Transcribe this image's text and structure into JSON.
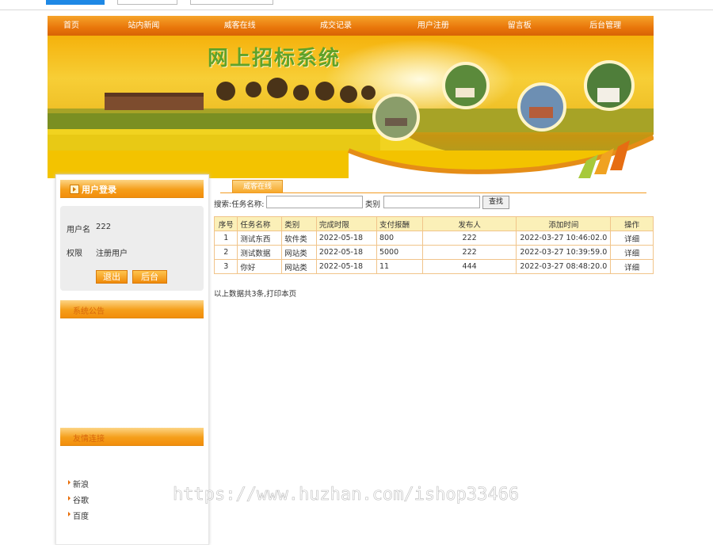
{
  "colors": {
    "accent": "#f28d0b",
    "nav_top": "#f6a42a",
    "nav_bottom": "#d86405",
    "table_head_bg": "#fbf0b8",
    "table_border": "#f1c48a"
  },
  "nav": [
    {
      "label": "首页"
    },
    {
      "label": "站内新闻"
    },
    {
      "label": "威客在线"
    },
    {
      "label": "成交记录"
    },
    {
      "label": "用户注册"
    },
    {
      "label": "留言板"
    },
    {
      "label": "后台管理"
    }
  ],
  "banner": {
    "title": "网上招标系统"
  },
  "login": {
    "title": "用户登录",
    "username_label": "用户名",
    "username_value": "222",
    "role_label": "权限",
    "role_value": "注册用户",
    "logout_button": "退出",
    "admin_button": "后台",
    "icon": "arrow-right-icon"
  },
  "notice": {
    "title": "系统公告"
  },
  "links": {
    "title": "友情连接",
    "items": [
      "新浪",
      "谷歌",
      "百度"
    ]
  },
  "main": {
    "tab_label": "威客在线",
    "search": {
      "label_prefix": "搜索:任务名称:",
      "category_label": "类别",
      "task_name_value": "",
      "category_value": "",
      "button": "查找"
    },
    "table": {
      "headers": [
        "序号",
        "任务名称",
        "类别",
        "完成时限",
        "支付报酬",
        "发布人",
        "添加时间",
        "操作"
      ],
      "rows": [
        [
          "1",
          "测试东西",
          "软件类",
          "2022-05-18",
          "800",
          "222",
          "2022-03-27 10:46:02.0",
          "详细"
        ],
        [
          "2",
          "测试数据",
          "网站类",
          "2022-05-18",
          "5000",
          "222",
          "2022-03-27 10:39:59.0",
          "详细"
        ],
        [
          "3",
          "你好",
          "网站类",
          "2022-05-18",
          "11",
          "444",
          "2022-03-27 08:48:20.0",
          "详细"
        ]
      ]
    },
    "summary": "以上数据共3条,打印本页"
  },
  "watermark": "https://www.huzhan.com/ishop33466"
}
